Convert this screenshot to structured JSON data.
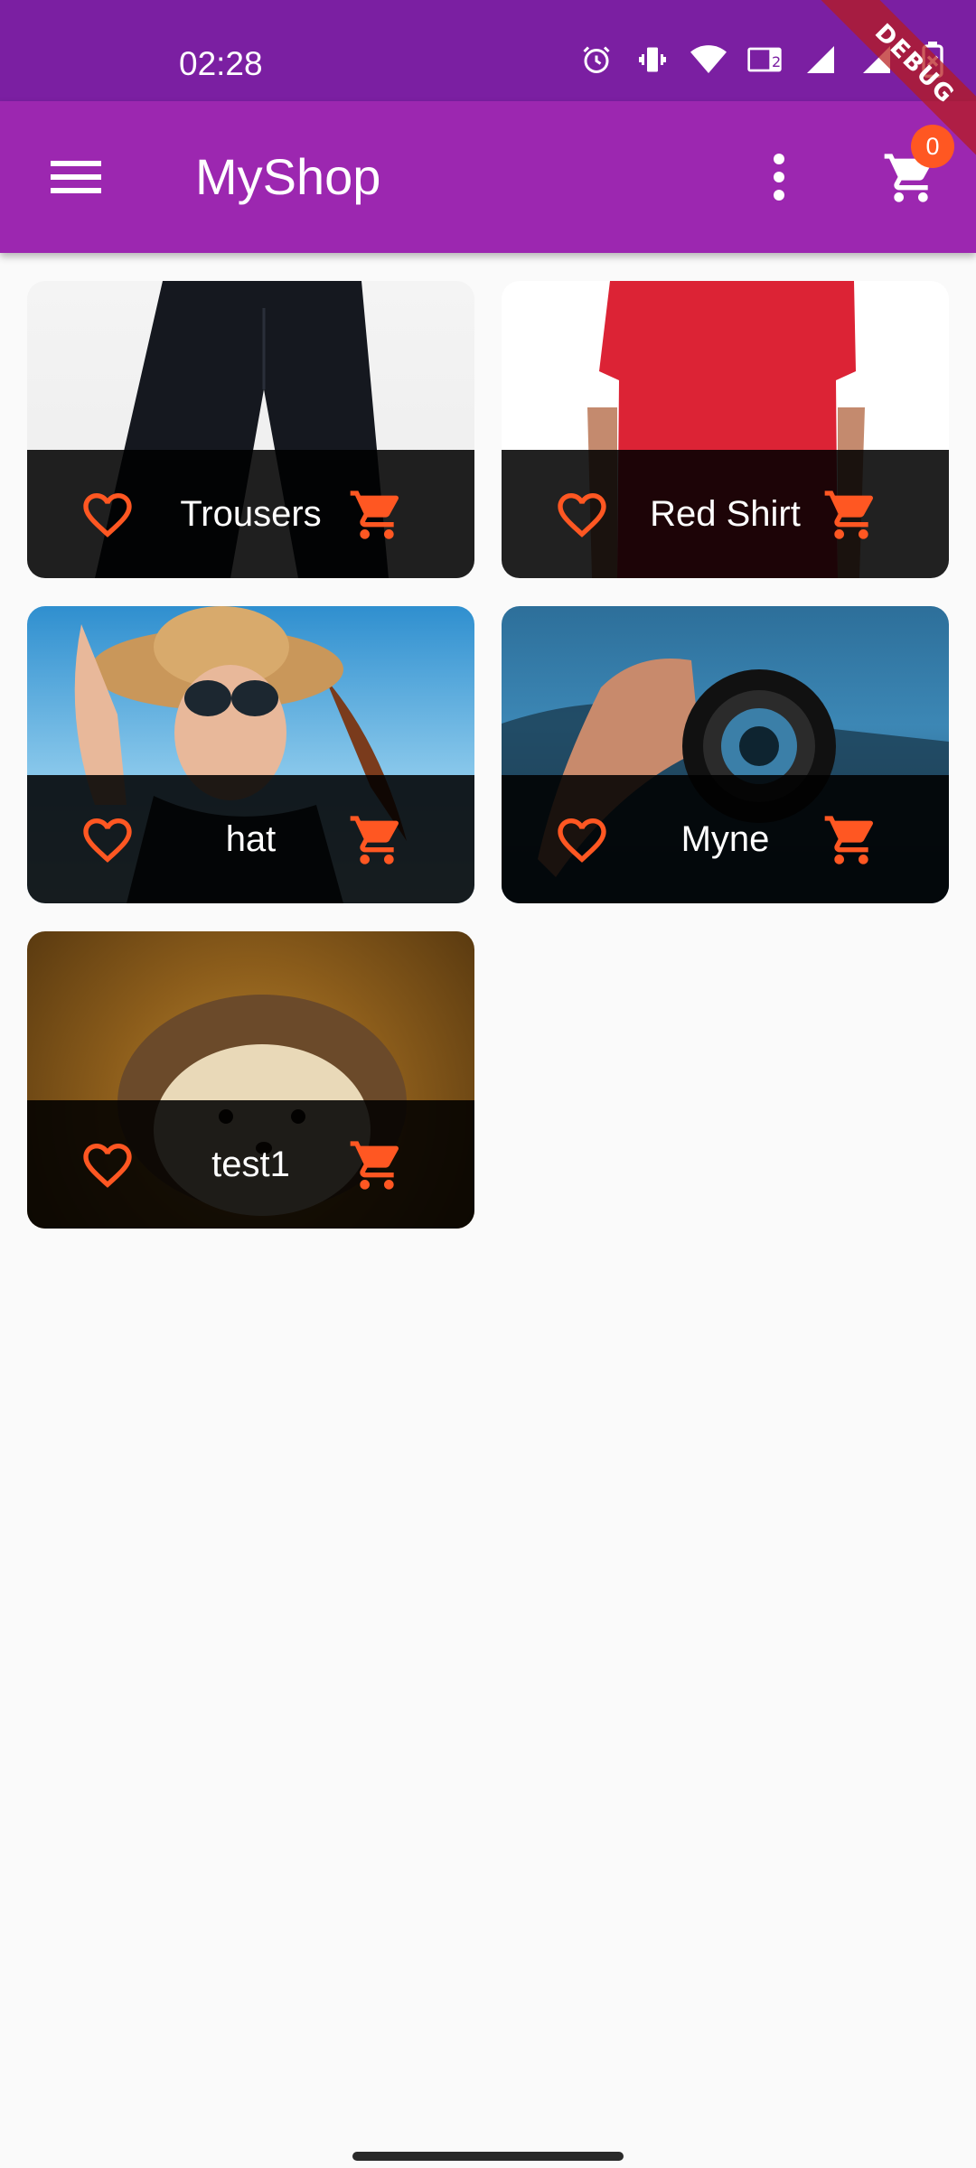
{
  "status_bar": {
    "time": "02:28",
    "icons": [
      "alarm-icon",
      "vibrate-icon",
      "wifi-icon",
      "volte-icon",
      "signal-icon",
      "signal-roaming-icon",
      "battery-icon"
    ]
  },
  "debug_banner": {
    "label": "DEBUG"
  },
  "app_bar": {
    "title": "MyShop",
    "cart_count": "0"
  },
  "products": [
    {
      "title": "Trousers",
      "image": "trousers"
    },
    {
      "title": "Red Shirt",
      "image": "red-shirt"
    },
    {
      "title": "hat",
      "image": "hat"
    },
    {
      "title": "Myne",
      "image": "camera-lens"
    },
    {
      "title": "test1",
      "image": "hedgehog"
    }
  ],
  "colors": {
    "status_bar": "#7b1fa2",
    "app_bar": "#9c27b0",
    "accent": "#ff5722",
    "background": "#fafafa",
    "tile_footer": "#000000"
  }
}
